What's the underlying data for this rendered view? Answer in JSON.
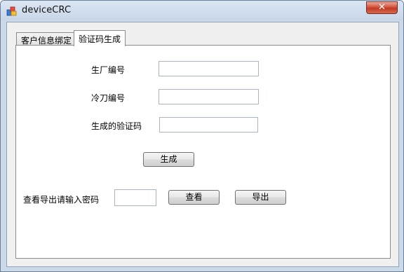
{
  "window": {
    "title": "deviceCRC",
    "close_symbol": "✕"
  },
  "tabs": [
    {
      "label": "客户信息绑定",
      "selected": false
    },
    {
      "label": "验证码生成",
      "selected": true
    }
  ],
  "form": {
    "manufacturer_label": "生厂编号",
    "manufacturer_value": "",
    "blade_label": "冷刀编号",
    "blade_value": "",
    "code_label": "生成的验证码",
    "code_value": "",
    "generate_label": "生成",
    "password_label": "查看导出请输入密码",
    "password_value": "",
    "view_label": "查看",
    "export_label": "导出"
  }
}
